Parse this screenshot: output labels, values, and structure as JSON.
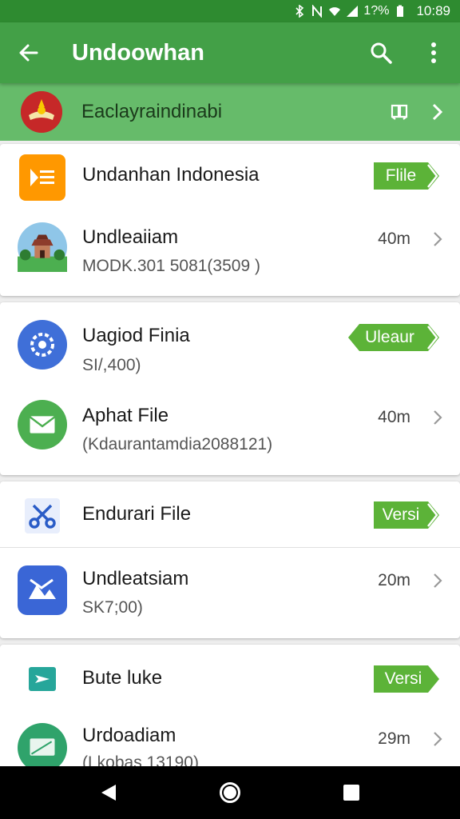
{
  "status": {
    "battery_text": "1?%",
    "time": "10:89"
  },
  "appbar": {
    "title": "Undoowhan"
  },
  "banner": {
    "text": "Eaclayraindinabi"
  },
  "items": [
    {
      "title": "Undanhan Indonesia",
      "tag": "Flile",
      "tag_color": "#5cb338"
    },
    {
      "title": "Undleaiiam",
      "subtitle": "MODK.301 5081(3509 )",
      "size": "40m"
    },
    {
      "title": "Uagiod Finia",
      "subtitle": "SI/,400)",
      "tag": "Uleaur",
      "tag_color": "#5cb338"
    },
    {
      "title": "Aphat File",
      "subtitle": "(Kdaurantamdia2088121)",
      "size": "40m"
    },
    {
      "title": "Endurari File",
      "tag": "Versi",
      "tag_color": "#5cb338"
    },
    {
      "title": "Undleatsiam",
      "subtitle": "SK7;00)",
      "size": "20m"
    },
    {
      "title": "Bute luke",
      "tag": "Versi",
      "tag_color": "#5cb338"
    },
    {
      "title": "Urdoadiam",
      "subtitle": "(Lkobas 13190)",
      "size": "29m"
    }
  ],
  "colors": {
    "statusbar": "#2e8b30",
    "appbar": "#43a047",
    "banner": "#66bb6a",
    "accent": "#5cb338"
  },
  "icons": [
    "back-arrow-icon",
    "search-icon",
    "more-vert-icon",
    "emblem-icon",
    "book-icon",
    "chevron-right-icon",
    "document-icon",
    "temple-icon",
    "settings-gear-icon",
    "mail-icon",
    "scissors-icon",
    "photo-icon",
    "send-icon",
    "file-icon"
  ]
}
